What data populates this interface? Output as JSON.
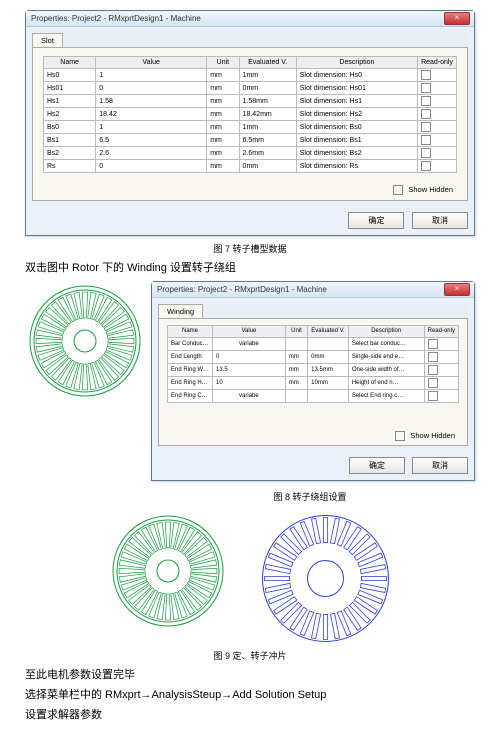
{
  "dialog1": {
    "title": "Properties: Project2 - RMxprtDesign1 - Machine",
    "close": "×",
    "tab": "Slot",
    "headers": [
      "Name",
      "Value",
      "Unit",
      "Evaluated V.",
      "Description",
      "Read-only"
    ],
    "rows": [
      {
        "name": "Hs0",
        "value": "1",
        "unit": "mm",
        "eval": "1mm",
        "desc": "Slot dimension: Hs0"
      },
      {
        "name": "Hs01",
        "value": "0",
        "unit": "mm",
        "eval": "0mm",
        "desc": "Slot dimension: Hs01"
      },
      {
        "name": "Hs1",
        "value": "1.58",
        "unit": "mm",
        "eval": "1.58mm",
        "desc": "Slot dimension: Hs1"
      },
      {
        "name": "Hs2",
        "value": "18.42",
        "unit": "mm",
        "eval": "18.42mm",
        "desc": "Slot dimension: Hs2"
      },
      {
        "name": "Bs0",
        "value": "1",
        "unit": "mm",
        "eval": "1mm",
        "desc": "Slot dimension: Bs0"
      },
      {
        "name": "Bs1",
        "value": "6.5",
        "unit": "mm",
        "eval": "6.5mm",
        "desc": "Slot dimension: Bs1"
      },
      {
        "name": "Bs2",
        "value": "2.6",
        "unit": "mm",
        "eval": "2.6mm",
        "desc": "Slot dimension: Bs2"
      },
      {
        "name": "Rs",
        "value": "0",
        "unit": "mm",
        "eval": "0mm",
        "desc": "Slot dimension: Rs"
      }
    ],
    "showHidden": "Show Hidden",
    "ok": "确定",
    "cancel": "取消"
  },
  "caption7": "图 7 转子槽型数据",
  "text1": "双击图中 Rotor 下的 Winding 设置转子绕组",
  "dialog2": {
    "title": "Properties: Project2 - RMxprtDesign1 - Machine",
    "close": "×",
    "tab": "Winding",
    "headers": [
      "Name",
      "Value",
      "Unit",
      "Evaluated V.",
      "Description",
      "Read-only"
    ],
    "rows": [
      {
        "name": "Bar Conduc…",
        "value": "variabe",
        "unit": "",
        "eval": "",
        "desc": "Select bar conduc…"
      },
      {
        "name": "End Length",
        "value": "0",
        "unit": "mm",
        "eval": "0mm",
        "desc": "Single-side end e…"
      },
      {
        "name": "End Ring W…",
        "value": "13.5",
        "unit": "mm",
        "eval": "13.5mm",
        "desc": "One-side width of…"
      },
      {
        "name": "End Ring H…",
        "value": "10",
        "unit": "mm",
        "eval": "10mm",
        "desc": "Height of end ri…"
      },
      {
        "name": "End Ring C…",
        "value": "variabe",
        "unit": "",
        "eval": "",
        "desc": "Select End ring c…"
      }
    ],
    "showHidden": "Show Hidden",
    "ok": "确定",
    "cancel": "取消"
  },
  "caption8": "图 8 转子绕组设置",
  "caption9": "图 9 定、转子冲片",
  "text2": "至此电机参数设置完毕",
  "text3": "选择菜单栏中的 RMxprt→AnalysisSteup→Add Solution Setup",
  "text4": "设置求解器参数",
  "colors": {
    "statorStroke": "#169c3c",
    "rotorStroke": "#2a3fda"
  }
}
